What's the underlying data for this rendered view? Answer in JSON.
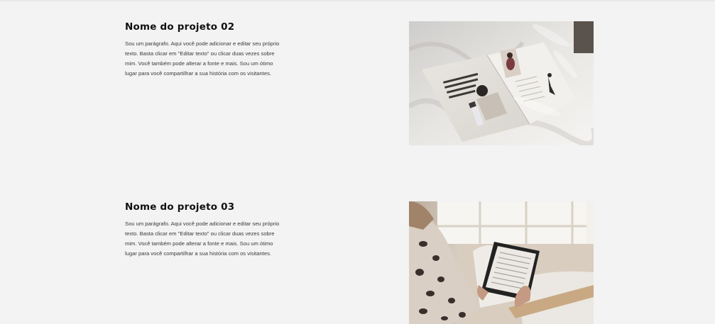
{
  "projects": [
    {
      "title": "Nome do projeto 02",
      "paragraph": "Sou um parágrafo. Aqui você pode adicionar e editar seu próprio texto. Basta clicar em \"Editar texto\" ou clicar duas vezes sobre mim. Você também pode alterar a fonte e mais. Sou um ótimo lugar para você compartilhar a sua história com os visitantes.",
      "image_subject": "magazine-on-bed"
    },
    {
      "title": "Nome do projeto 03",
      "paragraph": "Sou um parágrafo. Aqui você pode adicionar e editar seu próprio texto. Basta clicar em \"Editar texto\" ou clicar duas vezes sobre mim. Você também pode alterar a fonte e mais. Sou um ótimo lugar para você compartilhar a sua história com os visitantes.",
      "image_subject": "person-reading-tablet"
    }
  ],
  "colors": {
    "background": "#f3f3f3",
    "title": "#111111",
    "paragraph": "#3a3a3a"
  }
}
